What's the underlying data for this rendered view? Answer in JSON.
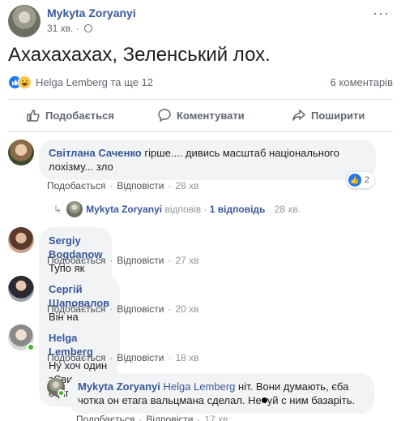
{
  "post": {
    "author": "Mykyta Zoryanyi",
    "time": "31 хв.",
    "text": "Ахахахахах, Зеленський лох.",
    "more": "···",
    "reactions": {
      "summary": "Helga Lemberg та ще 12",
      "comments_count": "6 коментарів"
    }
  },
  "actions": {
    "like": "Подобається",
    "comment": "Коментувати",
    "share": "Поширити"
  },
  "comments": [
    {
      "author": "Світлана Саченко",
      "text": "гірше.... дивись масштаб національного лохізму... зло",
      "like": "Подобається",
      "reply": "Відповісти",
      "time": "28 хв",
      "reaction_count": "2",
      "reply_line": {
        "author": "Mykyta Zoryanyi",
        "verb": "відповів",
        "count": "1 відповідь",
        "time": "28 хв."
      }
    },
    {
      "author": "Sergiy Bogdanow",
      "text": "Тупо як гопота себе поводив",
      "like": "Подобається",
      "reply": "Відповісти",
      "time": "27 хв"
    },
    {
      "author": "Сергій Шаповалов",
      "text": "Він на відходняках. Ото і зли як собака.",
      "like": "Подобається",
      "reply": "Відповісти",
      "time": "20 хв"
    },
    {
      "author": "Helga Lemberg",
      "text": "Ну хоч один зЄвиборець офігЄл?!",
      "like": "Подобається",
      "reply": "Відповісти",
      "time": "18 хв"
    }
  ],
  "nested_reply": {
    "author": "Mykyta Zoryanyi",
    "tag": "Helga Lemberg",
    "text_a": "ніт. Вони думають, єба чотка он етага вальцмана сделал. Не",
    "text_b": "уй с ним базаріть.",
    "like": "Подобається",
    "reply": "Відповісти",
    "time": "17 хв"
  },
  "sep": "·",
  "icons": [
    "more-options-icon",
    "globe-icon",
    "like-reaction-icon",
    "haha-reaction-icon",
    "like-icon",
    "comment-icon",
    "share-icon",
    "reply-arrow-icon"
  ],
  "colors": {
    "link": "#385898",
    "muted": "#90949c",
    "bubble": "#f2f3f5",
    "like_blue": "#2078f4",
    "online": "#42b72a"
  }
}
